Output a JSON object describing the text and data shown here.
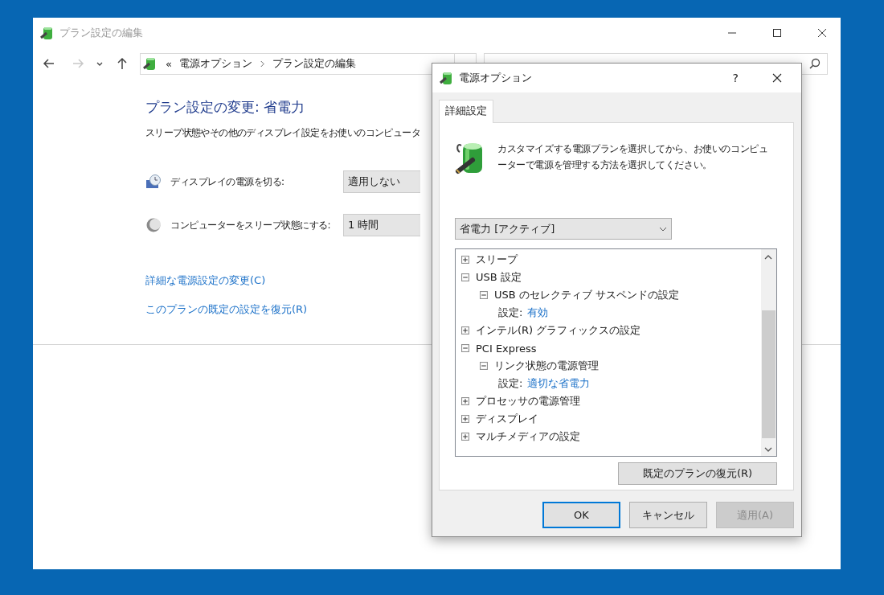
{
  "window": {
    "title": "プラン設定の編集"
  },
  "nav_buttons": [
    {
      "kind": "back",
      "disabled": false
    },
    {
      "kind": "forward",
      "disabled": true
    },
    {
      "kind": "recent",
      "disabled": false
    },
    {
      "kind": "up",
      "disabled": false
    }
  ],
  "address_bar": {
    "overflow": "«",
    "breadcrumbs": [
      "電源オプション",
      "プラン設定の編集"
    ]
  },
  "page": {
    "heading": "プラン設定の変更: 省電力",
    "description": "スリープ状態やその他のディスプレイ設定をお使いのコンピュータ",
    "settings": [
      {
        "kind": "display",
        "label": "ディスプレイの電源を切る:",
        "value": "適用しない"
      },
      {
        "kind": "sleep",
        "label": "コンピューターをスリープ状態にする:",
        "value": "1 時間"
      }
    ],
    "links": [
      "詳細な電源設定の変更(C)",
      "このプランの既定の設定を復元(R)"
    ]
  },
  "dialog": {
    "title": "電源オプション",
    "help": "?",
    "tabs": [
      {
        "label": "詳細設定",
        "selected": true
      }
    ],
    "intro": "カスタマイズする電源プランを選択してから、お使いのコンピューターで電源を管理する方法を選択してください。",
    "plan_select": {
      "value": "省電力 [アクティブ]"
    },
    "tree": [
      {
        "kind": "group",
        "label": "スリープ",
        "expanded": false
      },
      {
        "kind": "group",
        "label": "USB 設定",
        "expanded": true,
        "children": [
          {
            "kind": "group",
            "label": "USB のセレクティブ サスペンドの設定",
            "expanded": true,
            "children": [
              {
                "kind": "setting",
                "label": "設定:",
                "value": "有効"
              }
            ]
          }
        ]
      },
      {
        "kind": "group",
        "label": "インテル(R) グラフィックスの設定",
        "expanded": false
      },
      {
        "kind": "group",
        "label": "PCI Express",
        "expanded": true,
        "children": [
          {
            "kind": "group",
            "label": "リンク状態の電源管理",
            "expanded": true,
            "children": [
              {
                "kind": "setting",
                "label": "設定:",
                "value": "適切な省電力"
              }
            ]
          }
        ]
      },
      {
        "kind": "group",
        "label": "プロセッサの電源管理",
        "expanded": false
      },
      {
        "kind": "group",
        "label": "ディスプレイ",
        "expanded": false
      },
      {
        "kind": "group",
        "label": "マルチメディアの設定",
        "expanded": false
      }
    ],
    "restore_button": "既定のプランの復元(R)",
    "buttons": [
      {
        "label": "OK",
        "default": true,
        "disabled": false
      },
      {
        "label": "キャンセル",
        "default": false,
        "disabled": false
      },
      {
        "label": "適用(A)",
        "default": false,
        "disabled": true
      }
    ]
  }
}
